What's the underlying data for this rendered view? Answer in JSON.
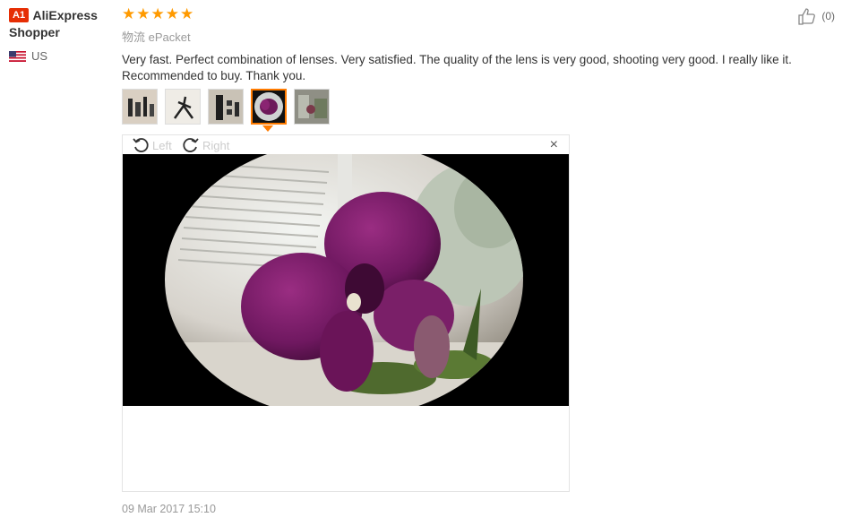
{
  "user": {
    "badge": "A1",
    "name": "AliExpress Shopper",
    "country": "US"
  },
  "review": {
    "stars": "★★★★★",
    "logistics": "物流 ePacket",
    "text": "Very fast. Perfect combination of lenses. Very satisfied. The quality of the lens is very good, shooting very good. I really like it. Recommended to buy. Thank you.",
    "date": "09 Mar 2017 15:10",
    "rating": 5
  },
  "viewer": {
    "left_label": "Left",
    "right_label": "Right",
    "close_symbol": "×"
  },
  "helpful": {
    "count": "(0)"
  },
  "thumbnails": [
    {
      "name": "lens-kit-photo"
    },
    {
      "name": "tripod-photo"
    },
    {
      "name": "lens-set-photo"
    },
    {
      "name": "orchid-photo"
    },
    {
      "name": "room-photo"
    }
  ],
  "colors": {
    "star": "#ff9a00",
    "badge": "#e62e04",
    "active_thumb": "#ff7b00",
    "muted_text": "#999999"
  }
}
